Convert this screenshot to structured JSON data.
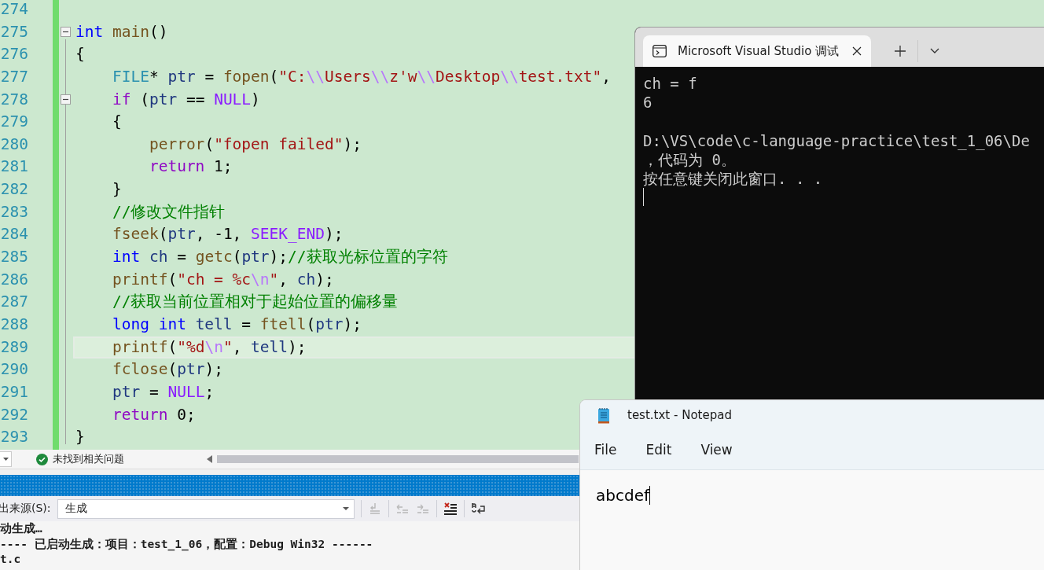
{
  "editor": {
    "lines": [
      {
        "number": "274",
        "fold_marker": false,
        "current": false
      },
      {
        "number": "275",
        "fold_marker": true,
        "current": false,
        "tokens": [
          {
            "text": "int",
            "kind": "keyword"
          },
          {
            "text": " main",
            "kind": "func"
          },
          {
            "text": "()",
            "kind": "plain"
          }
        ]
      },
      {
        "number": "276",
        "fold_marker": false,
        "current": false,
        "tokens": [
          {
            "text": "{",
            "kind": "plain"
          }
        ]
      },
      {
        "number": "277",
        "fold_marker": false,
        "current": false,
        "tokens": [
          {
            "text": "    FILE",
            "kind": "type"
          },
          {
            "text": "* ",
            "kind": "plain"
          },
          {
            "text": "ptr",
            "kind": "ident"
          },
          {
            "text": " = ",
            "kind": "plain"
          },
          {
            "text": "fopen",
            "kind": "func"
          },
          {
            "text": "(",
            "kind": "plain"
          },
          {
            "text": "\"C:",
            "kind": "string"
          },
          {
            "text": "\\\\",
            "kind": "escape"
          },
          {
            "text": "Users",
            "kind": "string"
          },
          {
            "text": "\\\\",
            "kind": "escape"
          },
          {
            "text": "z'w",
            "kind": "string"
          },
          {
            "text": "\\\\",
            "kind": "escape"
          },
          {
            "text": "Desktop",
            "kind": "string"
          },
          {
            "text": "\\\\",
            "kind": "escape"
          },
          {
            "text": "test.txt\"",
            "kind": "string"
          },
          {
            "text": ",",
            "kind": "plain"
          }
        ]
      },
      {
        "number": "278",
        "fold_marker": true,
        "current": false,
        "tokens": [
          {
            "text": "    if",
            "kind": "control"
          },
          {
            "text": " (",
            "kind": "plain"
          },
          {
            "text": "ptr",
            "kind": "ident"
          },
          {
            "text": " == ",
            "kind": "plain"
          },
          {
            "text": "NULL",
            "kind": "macro"
          },
          {
            "text": ")",
            "kind": "plain"
          }
        ]
      },
      {
        "number": "279",
        "fold_marker": false,
        "current": false,
        "tokens": [
          {
            "text": "    {",
            "kind": "plain"
          }
        ]
      },
      {
        "number": "280",
        "fold_marker": false,
        "current": false,
        "tokens": [
          {
            "text": "        perror",
            "kind": "func"
          },
          {
            "text": "(",
            "kind": "plain"
          },
          {
            "text": "\"fopen failed\"",
            "kind": "string"
          },
          {
            "text": ");",
            "kind": "plain"
          }
        ]
      },
      {
        "number": "281",
        "fold_marker": false,
        "current": false,
        "tokens": [
          {
            "text": "        return",
            "kind": "control"
          },
          {
            "text": " 1;",
            "kind": "plain"
          }
        ]
      },
      {
        "number": "282",
        "fold_marker": false,
        "current": false,
        "tokens": [
          {
            "text": "    }",
            "kind": "plain"
          }
        ]
      },
      {
        "number": "283",
        "fold_marker": false,
        "current": false,
        "tokens": [
          {
            "text": "    //修改文件指针",
            "kind": "comment"
          }
        ]
      },
      {
        "number": "284",
        "fold_marker": false,
        "current": false,
        "tokens": [
          {
            "text": "    fseek",
            "kind": "func"
          },
          {
            "text": "(",
            "kind": "plain"
          },
          {
            "text": "ptr",
            "kind": "ident"
          },
          {
            "text": ", -1, ",
            "kind": "plain"
          },
          {
            "text": "SEEK_END",
            "kind": "macro"
          },
          {
            "text": ");",
            "kind": "plain"
          }
        ]
      },
      {
        "number": "285",
        "fold_marker": false,
        "current": false,
        "tokens": [
          {
            "text": "    int",
            "kind": "keyword"
          },
          {
            "text": " ch",
            "kind": "ident"
          },
          {
            "text": " = ",
            "kind": "plain"
          },
          {
            "text": "getc",
            "kind": "func"
          },
          {
            "text": "(",
            "kind": "plain"
          },
          {
            "text": "ptr",
            "kind": "ident"
          },
          {
            "text": ");",
            "kind": "plain"
          },
          {
            "text": "//获取光标位置的字符",
            "kind": "comment"
          }
        ]
      },
      {
        "number": "286",
        "fold_marker": false,
        "current": false,
        "tokens": [
          {
            "text": "    printf",
            "kind": "func"
          },
          {
            "text": "(",
            "kind": "plain"
          },
          {
            "text": "\"ch = %c",
            "kind": "string"
          },
          {
            "text": "\\n",
            "kind": "escape"
          },
          {
            "text": "\"",
            "kind": "string"
          },
          {
            "text": ", ",
            "kind": "plain"
          },
          {
            "text": "ch",
            "kind": "ident"
          },
          {
            "text": ");",
            "kind": "plain"
          }
        ]
      },
      {
        "number": "287",
        "fold_marker": false,
        "current": false,
        "tokens": [
          {
            "text": "    //获取当前位置相对于起始位置的偏移量",
            "kind": "comment"
          }
        ]
      },
      {
        "number": "288",
        "fold_marker": false,
        "current": false,
        "tokens": [
          {
            "text": "    long int",
            "kind": "keyword"
          },
          {
            "text": " tell",
            "kind": "ident"
          },
          {
            "text": " = ",
            "kind": "plain"
          },
          {
            "text": "ftell",
            "kind": "func"
          },
          {
            "text": "(",
            "kind": "plain"
          },
          {
            "text": "ptr",
            "kind": "ident"
          },
          {
            "text": ");",
            "kind": "plain"
          }
        ]
      },
      {
        "number": "289",
        "fold_marker": false,
        "current": true,
        "tokens": [
          {
            "text": "    printf",
            "kind": "func"
          },
          {
            "text": "(",
            "kind": "plain"
          },
          {
            "text": "\"%d",
            "kind": "string"
          },
          {
            "text": "\\n",
            "kind": "escape"
          },
          {
            "text": "\"",
            "kind": "string"
          },
          {
            "text": ", ",
            "kind": "plain"
          },
          {
            "text": "tell",
            "kind": "ident"
          },
          {
            "text": ");",
            "kind": "plain"
          }
        ]
      },
      {
        "number": "290",
        "fold_marker": false,
        "current": false,
        "tokens": [
          {
            "text": "    fclose",
            "kind": "func"
          },
          {
            "text": "(",
            "kind": "plain"
          },
          {
            "text": "ptr",
            "kind": "ident"
          },
          {
            "text": ");",
            "kind": "plain"
          }
        ]
      },
      {
        "number": "291",
        "fold_marker": false,
        "current": false,
        "tokens": [
          {
            "text": "    ptr",
            "kind": "ident"
          },
          {
            "text": " = ",
            "kind": "plain"
          },
          {
            "text": "NULL",
            "kind": "macro"
          },
          {
            "text": ";",
            "kind": "plain"
          }
        ]
      },
      {
        "number": "292",
        "fold_marker": false,
        "current": false,
        "tokens": [
          {
            "text": "    return",
            "kind": "control"
          },
          {
            "text": " 0;",
            "kind": "plain"
          }
        ]
      },
      {
        "number": "293",
        "fold_marker": false,
        "current": false,
        "tokens": [
          {
            "text": "}",
            "kind": "plain"
          }
        ]
      }
    ],
    "status": {
      "issues": "未找到相关问题"
    }
  },
  "output_panel": {
    "source_label": "出来源(S):",
    "source_value": "生成",
    "lines": [
      "动生成…",
      "---- 已启动生成：项目：test_1_06，配置：Debug Win32 ------",
      "t.c"
    ]
  },
  "console_window": {
    "tab_title": "Microsoft Visual Studio 调试",
    "lines": [
      {
        "kind": "text",
        "text": "ch = f"
      },
      {
        "kind": "text",
        "text": "6"
      },
      {
        "kind": "blank"
      },
      {
        "kind": "text",
        "text": "D:\\VS\\code\\c-language-practice\\test_1_06\\De"
      },
      {
        "kind": "text",
        "text": "，代码为 0。"
      },
      {
        "kind": "text",
        "text": "按任意键关闭此窗口. . ."
      }
    ]
  },
  "notepad_window": {
    "title": "test.txt - Notepad",
    "menu": [
      "File",
      "Edit",
      "View"
    ],
    "content": "abcdef"
  }
}
